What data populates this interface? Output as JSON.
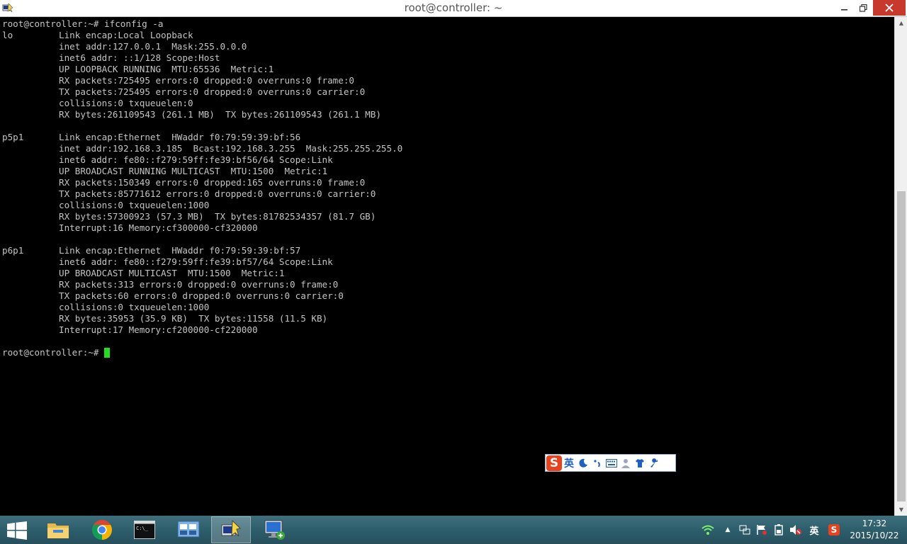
{
  "window": {
    "title": "root@controller: ~"
  },
  "terminal": {
    "lines": [
      {
        "c1": "root@controller:~# ifconfig -a",
        "c2": ""
      },
      {
        "c1": "lo",
        "c2": "Link encap:Local Loopback"
      },
      {
        "c1": "",
        "c2": "inet addr:127.0.0.1  Mask:255.0.0.0"
      },
      {
        "c1": "",
        "c2": "inet6 addr: ::1/128 Scope:Host"
      },
      {
        "c1": "",
        "c2": "UP LOOPBACK RUNNING  MTU:65536  Metric:1"
      },
      {
        "c1": "",
        "c2": "RX packets:725495 errors:0 dropped:0 overruns:0 frame:0"
      },
      {
        "c1": "",
        "c2": "TX packets:725495 errors:0 dropped:0 overruns:0 carrier:0"
      },
      {
        "c1": "",
        "c2": "collisions:0 txqueuelen:0"
      },
      {
        "c1": "",
        "c2": "RX bytes:261109543 (261.1 MB)  TX bytes:261109543 (261.1 MB)"
      },
      {
        "c1": "",
        "c2": ""
      },
      {
        "c1": "p5p1",
        "c2": "Link encap:Ethernet  HWaddr f0:79:59:39:bf:56"
      },
      {
        "c1": "",
        "c2": "inet addr:192.168.3.185  Bcast:192.168.3.255  Mask:255.255.255.0"
      },
      {
        "c1": "",
        "c2": "inet6 addr: fe80::f279:59ff:fe39:bf56/64 Scope:Link"
      },
      {
        "c1": "",
        "c2": "UP BROADCAST RUNNING MULTICAST  MTU:1500  Metric:1"
      },
      {
        "c1": "",
        "c2": "RX packets:150349 errors:0 dropped:165 overruns:0 frame:0"
      },
      {
        "c1": "",
        "c2": "TX packets:85771612 errors:0 dropped:0 overruns:0 carrier:0"
      },
      {
        "c1": "",
        "c2": "collisions:0 txqueuelen:1000"
      },
      {
        "c1": "",
        "c2": "RX bytes:57300923 (57.3 MB)  TX bytes:81782534357 (81.7 GB)"
      },
      {
        "c1": "",
        "c2": "Interrupt:16 Memory:cf300000-cf320000"
      },
      {
        "c1": "",
        "c2": ""
      },
      {
        "c1": "p6p1",
        "c2": "Link encap:Ethernet  HWaddr f0:79:59:39:bf:57"
      },
      {
        "c1": "",
        "c2": "inet6 addr: fe80::f279:59ff:fe39:bf57/64 Scope:Link"
      },
      {
        "c1": "",
        "c2": "UP BROADCAST MULTICAST  MTU:1500  Metric:1"
      },
      {
        "c1": "",
        "c2": "RX packets:313 errors:0 dropped:0 overruns:0 frame:0"
      },
      {
        "c1": "",
        "c2": "TX packets:60 errors:0 dropped:0 overruns:0 carrier:0"
      },
      {
        "c1": "",
        "c2": "collisions:0 txqueuelen:1000"
      },
      {
        "c1": "",
        "c2": "RX bytes:35953 (35.9 KB)  TX bytes:11558 (11.5 KB)"
      },
      {
        "c1": "",
        "c2": "Interrupt:17 Memory:cf200000-cf220000"
      },
      {
        "c1": "",
        "c2": ""
      },
      {
        "c1": "root@controller:~# ",
        "c2": ""
      }
    ],
    "cursor_color": "#22dd22"
  },
  "ime": {
    "logo": "S",
    "lang": "英",
    "icons": [
      "moon-icon",
      "punctuation-icon",
      "keyboard-icon",
      "user-icon",
      "shirt-icon",
      "wrench-icon"
    ]
  },
  "taskbar": {
    "apps": [
      "file-explorer-icon",
      "chrome-icon",
      "cmd-icon",
      "control-panel-icon",
      "putty-icon",
      "remote-desktop-icon"
    ],
    "tray": {
      "lang": "英",
      "time": "17:32",
      "date": "2015/10/22"
    }
  },
  "colors": {
    "close_button": "#c7382d",
    "taskbar": "#2d5e6c",
    "ime_logo": "#e8431f"
  }
}
